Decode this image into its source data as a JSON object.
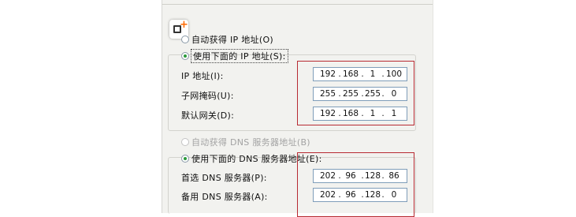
{
  "ip_section": {
    "auto_option": "自动获得 IP 地址(O)",
    "manual_option": "使用下面的 IP 地址(S):",
    "fields": [
      {
        "label": "IP 地址(I):",
        "octets": [
          "192",
          "168",
          "1",
          "100"
        ]
      },
      {
        "label": "子网掩码(U):",
        "octets": [
          "255",
          "255",
          "255",
          "0"
        ]
      },
      {
        "label": "默认网关(D):",
        "octets": [
          "192",
          "168",
          "1",
          "1"
        ]
      }
    ]
  },
  "dns_section": {
    "auto_option": "自动获得 DNS 服务器地址(B)",
    "manual_option": "使用下面的 DNS 服务器地址(E):",
    "fields": [
      {
        "label": "首选 DNS 服务器(P):",
        "octets": [
          "202",
          "96",
          "128",
          "86"
        ]
      },
      {
        "label": "备用 DNS 服务器(A):",
        "octets": [
          "202",
          "96",
          "128",
          "0"
        ]
      }
    ]
  },
  "colors": {
    "panel_background": "#f2f2ef",
    "highlight_border": "#b72a32",
    "selected_radio": "#2a9a3a",
    "input_border": "#7f9db9"
  },
  "icons": {
    "logo": "copy-plus-icon"
  }
}
